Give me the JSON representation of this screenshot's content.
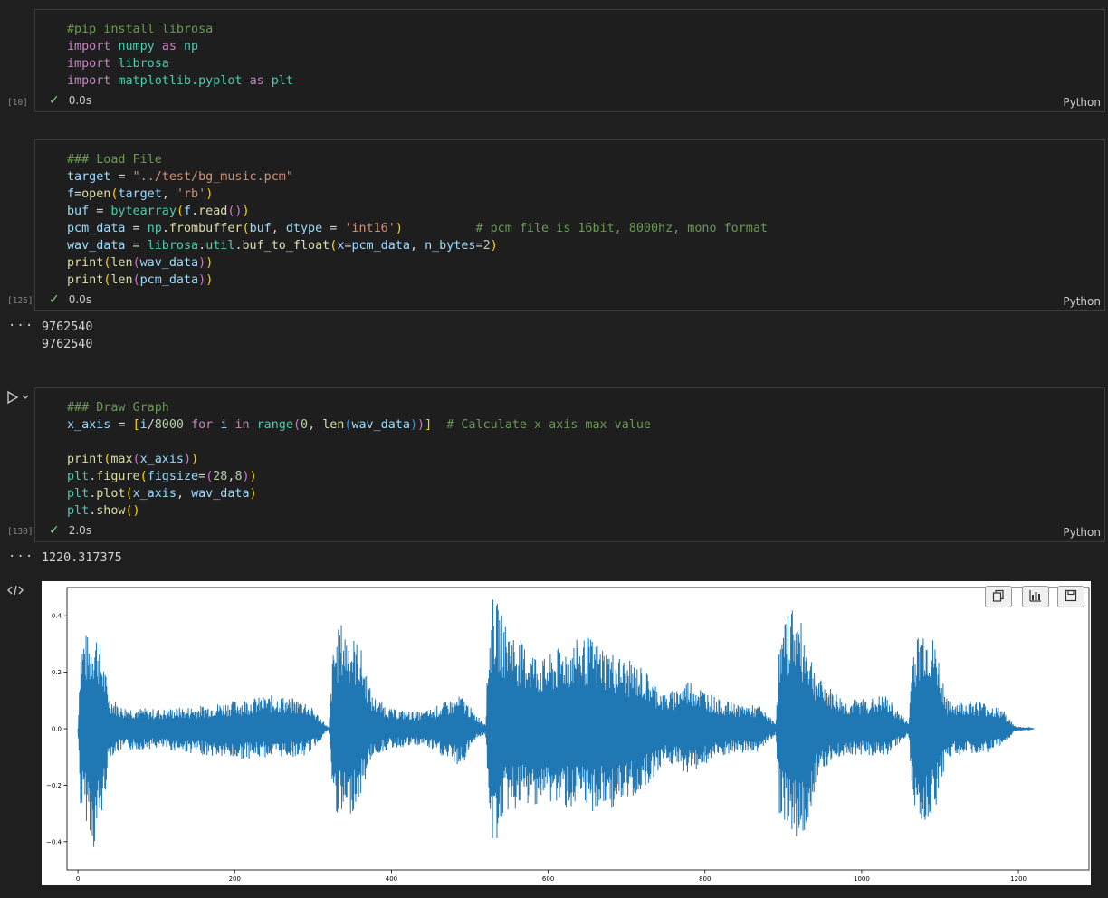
{
  "cells": [
    {
      "exec_count": "[10]",
      "status_time": "0.0s",
      "language": "Python",
      "lines": [
        [
          [
            "cm",
            "#pip install librosa"
          ]
        ],
        [
          [
            "kw",
            "import "
          ],
          [
            "mod",
            "numpy"
          ],
          [
            "op",
            " "
          ],
          [
            "kw",
            "as "
          ],
          [
            "mod",
            "np"
          ]
        ],
        [
          [
            "kw",
            "import "
          ],
          [
            "mod",
            "librosa"
          ]
        ],
        [
          [
            "kw",
            "import "
          ],
          [
            "mod",
            "matplotlib.pyplot"
          ],
          [
            "op",
            " "
          ],
          [
            "kw",
            "as "
          ],
          [
            "mod",
            "plt"
          ]
        ]
      ]
    },
    {
      "exec_count": "[125]",
      "status_time": "0.0s",
      "language": "Python",
      "lines": [
        [
          [
            "cm",
            "### Load File"
          ]
        ],
        [
          [
            "var",
            "target"
          ],
          [
            "op",
            " = "
          ],
          [
            "str",
            "\"../test/bg_music.pcm\""
          ]
        ],
        [
          [
            "var",
            "f"
          ],
          [
            "op",
            "="
          ],
          [
            "fn",
            "open"
          ],
          [
            "p1",
            "("
          ],
          [
            "var",
            "target"
          ],
          [
            "op",
            ", "
          ],
          [
            "str",
            "'rb'"
          ],
          [
            "p1",
            ")"
          ]
        ],
        [
          [
            "var",
            "buf"
          ],
          [
            "op",
            " = "
          ],
          [
            "bi",
            "bytearray"
          ],
          [
            "p1",
            "("
          ],
          [
            "var",
            "f"
          ],
          [
            "op",
            "."
          ],
          [
            "fn",
            "read"
          ],
          [
            "p2",
            "()"
          ],
          [
            "p1",
            ")"
          ]
        ],
        [
          [
            "var",
            "pcm_data"
          ],
          [
            "op",
            " = "
          ],
          [
            "mod",
            "np"
          ],
          [
            "op",
            "."
          ],
          [
            "fn",
            "frombuffer"
          ],
          [
            "p1",
            "("
          ],
          [
            "var",
            "buf"
          ],
          [
            "op",
            ", "
          ],
          [
            "var",
            "dtype"
          ],
          [
            "op",
            " = "
          ],
          [
            "str",
            "'int16'"
          ],
          [
            "p1",
            ")"
          ],
          [
            "op",
            "          "
          ],
          [
            "cm",
            "# pcm file is 16bit, 8000hz, mono format"
          ]
        ],
        [
          [
            "var",
            "wav_data"
          ],
          [
            "op",
            " = "
          ],
          [
            "mod",
            "librosa"
          ],
          [
            "op",
            "."
          ],
          [
            "mod",
            "util"
          ],
          [
            "op",
            "."
          ],
          [
            "fn",
            "buf_to_float"
          ],
          [
            "p1",
            "("
          ],
          [
            "var",
            "x"
          ],
          [
            "op",
            "="
          ],
          [
            "var",
            "pcm_data"
          ],
          [
            "op",
            ", "
          ],
          [
            "var",
            "n_bytes"
          ],
          [
            "op",
            "="
          ],
          [
            "num",
            "2"
          ],
          [
            "p1",
            ")"
          ]
        ],
        [
          [
            "fn",
            "print"
          ],
          [
            "p1",
            "("
          ],
          [
            "fn",
            "len"
          ],
          [
            "p2",
            "("
          ],
          [
            "var",
            "wav_data"
          ],
          [
            "p2",
            ")"
          ],
          [
            "p1",
            ")"
          ]
        ],
        [
          [
            "fn",
            "print"
          ],
          [
            "p1",
            "("
          ],
          [
            "fn",
            "len"
          ],
          [
            "p2",
            "("
          ],
          [
            "var",
            "pcm_data"
          ],
          [
            "p2",
            ")"
          ],
          [
            "p1",
            ")"
          ]
        ]
      ],
      "output": "9762540\n9762540"
    },
    {
      "exec_count": "[130]",
      "status_time": "2.0s",
      "language": "Python",
      "lines": [
        [
          [
            "cm",
            "### Draw Graph"
          ]
        ],
        [
          [
            "var",
            "x_axis"
          ],
          [
            "op",
            " = "
          ],
          [
            "p1",
            "["
          ],
          [
            "var",
            "i"
          ],
          [
            "op",
            "/"
          ],
          [
            "num",
            "8000"
          ],
          [
            "op",
            " "
          ],
          [
            "kw",
            "for"
          ],
          [
            "op",
            " "
          ],
          [
            "var",
            "i"
          ],
          [
            "op",
            " "
          ],
          [
            "kw",
            "in"
          ],
          [
            "op",
            " "
          ],
          [
            "bi",
            "range"
          ],
          [
            "p2",
            "("
          ],
          [
            "num",
            "0"
          ],
          [
            "op",
            ", "
          ],
          [
            "fn",
            "len"
          ],
          [
            "p3",
            "("
          ],
          [
            "var",
            "wav_data"
          ],
          [
            "p3",
            ")"
          ],
          [
            "p2",
            ")"
          ],
          [
            "p1",
            "]"
          ],
          [
            "op",
            "  "
          ],
          [
            "cm",
            "# Calculate x axis max value"
          ]
        ],
        [],
        [
          [
            "fn",
            "print"
          ],
          [
            "p1",
            "("
          ],
          [
            "fn",
            "max"
          ],
          [
            "p2",
            "("
          ],
          [
            "var",
            "x_axis"
          ],
          [
            "p2",
            ")"
          ],
          [
            "p1",
            ")"
          ]
        ],
        [
          [
            "mod",
            "plt"
          ],
          [
            "op",
            "."
          ],
          [
            "fn",
            "figure"
          ],
          [
            "p1",
            "("
          ],
          [
            "var",
            "figsize"
          ],
          [
            "op",
            "="
          ],
          [
            "p2",
            "("
          ],
          [
            "num",
            "28"
          ],
          [
            "op",
            ","
          ],
          [
            "num",
            "8"
          ],
          [
            "p2",
            ")"
          ],
          [
            "p1",
            ")"
          ]
        ],
        [
          [
            "mod",
            "plt"
          ],
          [
            "op",
            "."
          ],
          [
            "fn",
            "plot"
          ],
          [
            "p1",
            "("
          ],
          [
            "var",
            "x_axis"
          ],
          [
            "op",
            ", "
          ],
          [
            "var",
            "wav_data"
          ],
          [
            "p1",
            ")"
          ]
        ],
        [
          [
            "mod",
            "plt"
          ],
          [
            "op",
            "."
          ],
          [
            "fn",
            "show"
          ],
          [
            "p1",
            "()"
          ]
        ]
      ],
      "output": "1220.317375"
    }
  ],
  "gutter": {
    "output_menu_glyph": "···",
    "run_icon": "run-cell-icon",
    "code_icon": "code-output-icon"
  },
  "plot_toolbar": [
    {
      "icon": "copy-icon"
    },
    {
      "icon": "chart-icon"
    },
    {
      "icon": "save-icon"
    }
  ],
  "chart_data": {
    "type": "line",
    "color": "#1f77b4",
    "xlim": [
      -14,
      1290
    ],
    "ylim": [
      -0.5,
      0.5
    ],
    "x_ticks": [
      0,
      200,
      400,
      600,
      800,
      1000,
      1200
    ],
    "x_tick_labels": [
      "0",
      "200",
      "400",
      "600",
      "800",
      "1000",
      "1200"
    ],
    "y_ticks": [
      0.4,
      0.2,
      0.0,
      -0.2,
      -0.4
    ],
    "y_tick_labels": [
      "0.4",
      "0.2",
      "0.0",
      "−0.2",
      "−0.4"
    ],
    "x_max": 1220.317375,
    "envelope": [
      {
        "x": 0,
        "hi": 0.0,
        "lo": 0.0
      },
      {
        "x": 3,
        "hi": 0.3,
        "lo": -0.28
      },
      {
        "x": 8,
        "hi": 0.35,
        "lo": -0.32
      },
      {
        "x": 15,
        "hi": 0.32,
        "lo": -0.35
      },
      {
        "x": 19,
        "hi": 0.36,
        "lo": -0.45
      },
      {
        "x": 25,
        "hi": 0.35,
        "lo": -0.38
      },
      {
        "x": 32,
        "hi": 0.25,
        "lo": -0.3
      },
      {
        "x": 40,
        "hi": 0.12,
        "lo": -0.1
      },
      {
        "x": 55,
        "hi": 0.08,
        "lo": -0.08
      },
      {
        "x": 100,
        "hi": 0.07,
        "lo": -0.07
      },
      {
        "x": 150,
        "hi": 0.08,
        "lo": -0.09
      },
      {
        "x": 200,
        "hi": 0.1,
        "lo": -0.11
      },
      {
        "x": 250,
        "hi": 0.12,
        "lo": -0.1
      },
      {
        "x": 290,
        "hi": 0.1,
        "lo": -0.1
      },
      {
        "x": 310,
        "hi": 0.04,
        "lo": -0.04
      },
      {
        "x": 320,
        "hi": 0.0,
        "lo": 0.0
      },
      {
        "x": 326,
        "hi": 0.3,
        "lo": -0.28
      },
      {
        "x": 335,
        "hi": 0.38,
        "lo": -0.33
      },
      {
        "x": 345,
        "hi": 0.35,
        "lo": -0.32
      },
      {
        "x": 360,
        "hi": 0.3,
        "lo": -0.25
      },
      {
        "x": 375,
        "hi": 0.12,
        "lo": -0.1
      },
      {
        "x": 400,
        "hi": 0.07,
        "lo": -0.07
      },
      {
        "x": 440,
        "hi": 0.06,
        "lo": -0.06
      },
      {
        "x": 490,
        "hi": 0.12,
        "lo": -0.14
      },
      {
        "x": 505,
        "hi": 0.06,
        "lo": -0.04
      },
      {
        "x": 520,
        "hi": 0.02,
        "lo": -0.02
      },
      {
        "x": 524,
        "hi": 0.32,
        "lo": -0.3
      },
      {
        "x": 530,
        "hi": 0.48,
        "lo": -0.44
      },
      {
        "x": 545,
        "hi": 0.38,
        "lo": -0.3
      },
      {
        "x": 570,
        "hi": 0.3,
        "lo": -0.28
      },
      {
        "x": 595,
        "hi": 0.25,
        "lo": -0.26
      },
      {
        "x": 620,
        "hi": 0.3,
        "lo": -0.28
      },
      {
        "x": 650,
        "hi": 0.33,
        "lo": -0.3
      },
      {
        "x": 690,
        "hi": 0.26,
        "lo": -0.28
      },
      {
        "x": 720,
        "hi": 0.22,
        "lo": -0.22
      },
      {
        "x": 750,
        "hi": 0.12,
        "lo": -0.12
      },
      {
        "x": 780,
        "hi": 0.18,
        "lo": -0.16
      },
      {
        "x": 820,
        "hi": 0.1,
        "lo": -0.1
      },
      {
        "x": 870,
        "hi": 0.08,
        "lo": -0.08
      },
      {
        "x": 890,
        "hi": 0.02,
        "lo": -0.02
      },
      {
        "x": 895,
        "hi": 0.3,
        "lo": -0.3
      },
      {
        "x": 910,
        "hi": 0.46,
        "lo": -0.36
      },
      {
        "x": 925,
        "hi": 0.36,
        "lo": -0.42
      },
      {
        "x": 945,
        "hi": 0.18,
        "lo": -0.15
      },
      {
        "x": 980,
        "hi": 0.1,
        "lo": -0.09
      },
      {
        "x": 1030,
        "hi": 0.12,
        "lo": -0.1
      },
      {
        "x": 1060,
        "hi": 0.02,
        "lo": -0.02
      },
      {
        "x": 1065,
        "hi": 0.3,
        "lo": -0.28
      },
      {
        "x": 1080,
        "hi": 0.38,
        "lo": -0.35
      },
      {
        "x": 1095,
        "hi": 0.3,
        "lo": -0.27
      },
      {
        "x": 1110,
        "hi": 0.1,
        "lo": -0.1
      },
      {
        "x": 1150,
        "hi": 0.1,
        "lo": -0.09
      },
      {
        "x": 1180,
        "hi": 0.07,
        "lo": -0.07
      },
      {
        "x": 1195,
        "hi": 0.01,
        "lo": -0.01
      },
      {
        "x": 1220.317375,
        "hi": 0.0,
        "lo": 0.0
      }
    ]
  }
}
